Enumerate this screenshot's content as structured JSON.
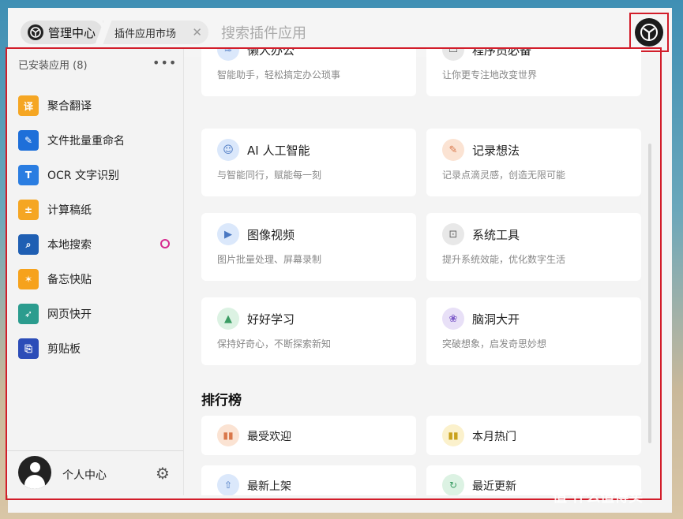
{
  "topbar": {
    "home_label": "管理中心",
    "tab_label": "插件应用市场",
    "search_placeholder": "搜索插件应用"
  },
  "sidebar": {
    "header": "已安装应用 (8)",
    "more_label": "•••",
    "items": [
      {
        "label": "聚合翻译",
        "icon": "translate-icon",
        "color": "#f5a623"
      },
      {
        "label": "文件批量重命名",
        "icon": "pencil-icon",
        "color": "#1e6fd9"
      },
      {
        "label": "OCR 文字识别",
        "icon": "ocr-icon",
        "color": "#2a7de1"
      },
      {
        "label": "计算稿纸",
        "icon": "calculator-icon",
        "color": "#f5a623"
      },
      {
        "label": "本地搜索",
        "icon": "search-icon",
        "color": "#1f5fb3"
      },
      {
        "label": "备忘快贴",
        "icon": "star-note-icon",
        "color": "#f6a21c"
      },
      {
        "label": "网页快开",
        "icon": "rocket-icon",
        "color": "#2b9c8e"
      },
      {
        "label": "剪贴板",
        "icon": "clipboard-icon",
        "color": "#2c4db8"
      }
    ],
    "profile_label": "个人中心"
  },
  "categories": [
    {
      "title": "懒人办公",
      "desc": "智能助手，轻松搞定办公琐事",
      "icon": "lazy-office-icon",
      "color": "#dbe8fb"
    },
    {
      "title": "程序员必备",
      "desc": "让你更专注地改变世界",
      "icon": "terminal-icon",
      "color": "#e8e8e8"
    },
    {
      "title": "AI 人工智能",
      "desc": "与智能同行，赋能每一刻",
      "icon": "ai-robot-icon",
      "color": "#dbe8fb"
    },
    {
      "title": "记录想法",
      "desc": "记录点滴灵感，创造无限可能",
      "icon": "pen-icon",
      "color": "#fbe3d3"
    },
    {
      "title": "图像视频",
      "desc": "图片批量处理、屏幕录制",
      "icon": "video-icon",
      "color": "#dbe8fb"
    },
    {
      "title": "系统工具",
      "desc": "提升系统效能，优化数字生活",
      "icon": "toolbox-icon",
      "color": "#e8e8e8"
    },
    {
      "title": "好好学习",
      "desc": "保持好奇心，不断探索新知",
      "icon": "graduation-icon",
      "color": "#dcf2e3"
    },
    {
      "title": "脑洞大开",
      "desc": "突破想象，启发奇思妙想",
      "icon": "brain-icon",
      "color": "#e8e0f7"
    }
  ],
  "ranking": {
    "title": "排行榜",
    "items": [
      {
        "title": "最受欢迎",
        "icon": "bar-chart-icon",
        "color": "#fbe3d3"
      },
      {
        "title": "本月热门",
        "icon": "bar-chart-icon",
        "color": "#fbf1cc"
      },
      {
        "title": "最新上架",
        "icon": "upload-icon",
        "color": "#dbe8fb"
      },
      {
        "title": "最近更新",
        "icon": "refresh-icon",
        "color": "#dcf2e3"
      }
    ]
  },
  "watermark": "值 什么值得买"
}
